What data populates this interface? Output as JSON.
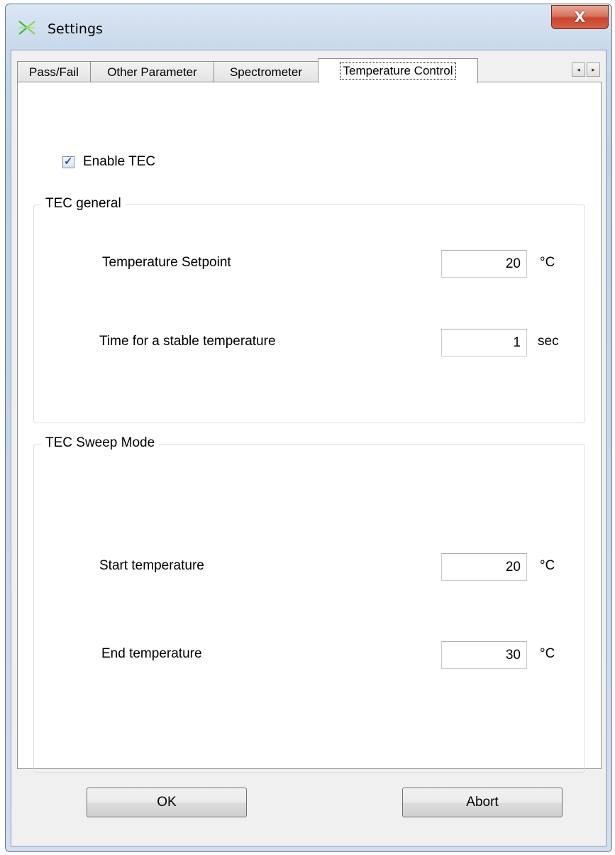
{
  "window": {
    "title": "Settings",
    "close_glyph": "X"
  },
  "tabs": [
    {
      "label": "Pass/Fail",
      "active": false
    },
    {
      "label": "Other Parameter",
      "active": false
    },
    {
      "label": "Spectrometer",
      "active": false
    },
    {
      "label": "Temperature Control",
      "active": true
    }
  ],
  "tab_scroll": {
    "left": "◂",
    "right": "▸"
  },
  "enable_tec": {
    "label": "Enable TEC",
    "checked": true,
    "mark": "✓"
  },
  "tec_general": {
    "title": "TEC general",
    "setpoint": {
      "label": "Temperature Setpoint",
      "value": "20",
      "unit": "°C"
    },
    "stable_time": {
      "label": "Time for a stable temperature",
      "value": "1",
      "unit": "sec"
    }
  },
  "tec_sweep": {
    "title": "TEC Sweep Mode",
    "start": {
      "label": "Start temperature",
      "value": "20",
      "unit": "°C"
    },
    "end": {
      "label": "End temperature",
      "value": "30",
      "unit": "°C"
    }
  },
  "buttons": {
    "ok": "OK",
    "abort": "Abort"
  },
  "colors": {
    "titlebar": "#c9d9ec",
    "close": "#c7452b",
    "panel": "#ffffff",
    "client": "#f0f0f0"
  },
  "icons": {
    "app": "signal-x-icon",
    "close": "close-icon",
    "check": "check-icon"
  }
}
